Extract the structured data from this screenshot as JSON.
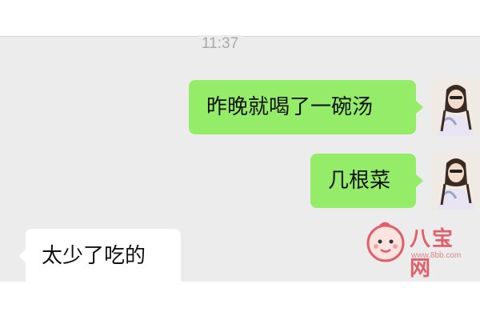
{
  "timestamp": "11:37",
  "messages": [
    {
      "side": "out",
      "text": "昨晚就喝了一碗汤"
    },
    {
      "side": "out",
      "text": "几根菜"
    },
    {
      "side": "in",
      "text": "太少了吃的"
    }
  ],
  "watermark": {
    "brand": "八宝网",
    "url": "www.8bb.com"
  },
  "colors": {
    "outgoing_bubble": "#95ec69",
    "incoming_bubble": "#ffffff",
    "chat_background": "#ececec",
    "watermark": "#e25f6a"
  }
}
